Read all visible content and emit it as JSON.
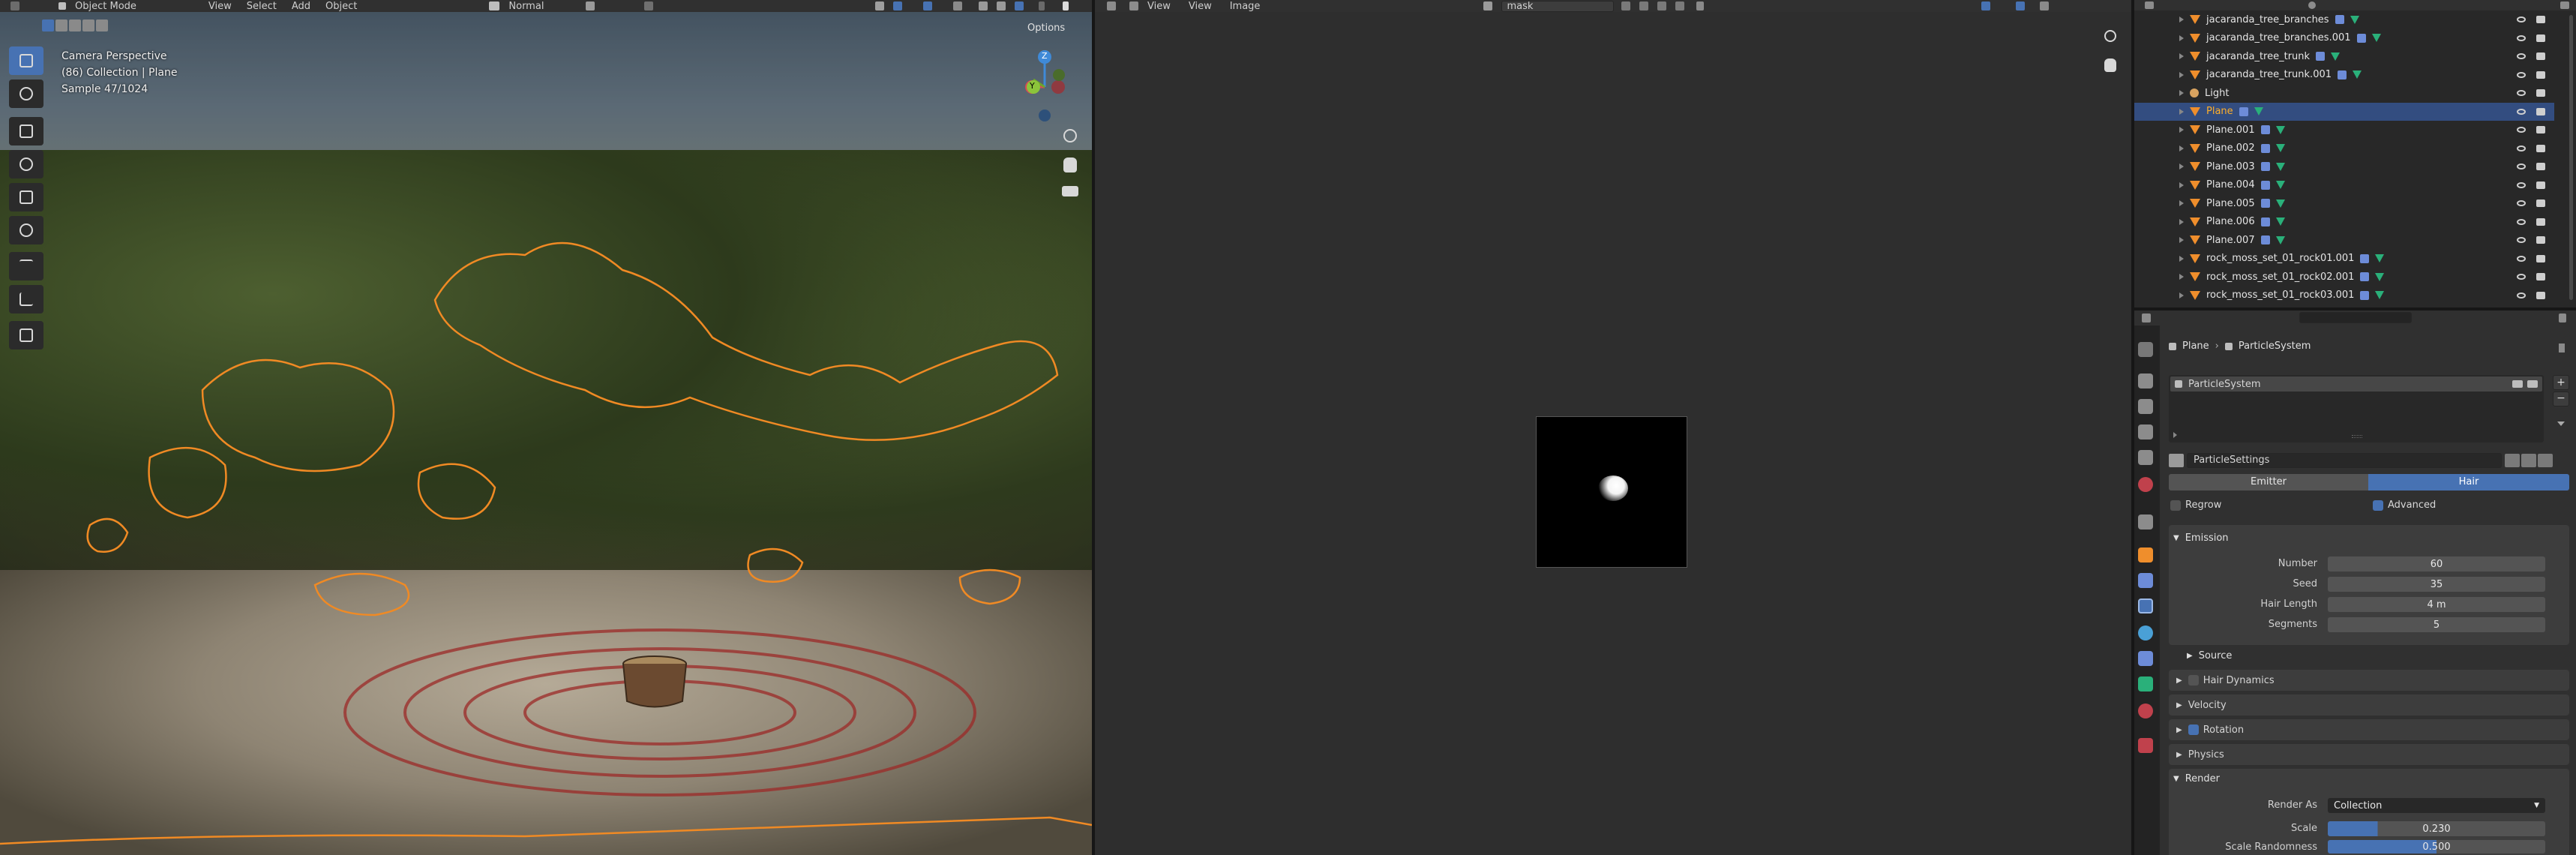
{
  "viewport_header": {
    "mode": "Object Mode",
    "menus": [
      "View",
      "Select",
      "Add",
      "Object"
    ],
    "orientation": "Normal",
    "options": "Options"
  },
  "viewport_overlay": {
    "line1": "Camera Perspective",
    "line2": "(86) Collection | Plane",
    "line3": "Sample 47/1024"
  },
  "gizmo": {
    "z": "Z",
    "y": "Y"
  },
  "image_editor": {
    "menus": [
      "View",
      "View",
      "Image"
    ],
    "image_name": "mask"
  },
  "outliner": {
    "items": [
      {
        "name": "jacaranda_tree_branches",
        "type": "mesh",
        "selected": false
      },
      {
        "name": "jacaranda_tree_branches.001",
        "type": "mesh",
        "selected": false
      },
      {
        "name": "jacaranda_tree_trunk",
        "type": "mesh",
        "selected": false
      },
      {
        "name": "jacaranda_tree_trunk.001",
        "type": "mesh",
        "selected": false
      },
      {
        "name": "Light",
        "type": "light",
        "selected": false
      },
      {
        "name": "Plane",
        "type": "mesh",
        "selected": true
      },
      {
        "name": "Plane.001",
        "type": "mesh",
        "selected": false
      },
      {
        "name": "Plane.002",
        "type": "mesh",
        "selected": false
      },
      {
        "name": "Plane.003",
        "type": "mesh",
        "selected": false
      },
      {
        "name": "Plane.004",
        "type": "mesh",
        "selected": false
      },
      {
        "name": "Plane.005",
        "type": "mesh",
        "selected": false
      },
      {
        "name": "Plane.006",
        "type": "mesh",
        "selected": false
      },
      {
        "name": "Plane.007",
        "type": "mesh",
        "selected": false
      },
      {
        "name": "rock_moss_set_01_rock01.001",
        "type": "mesh",
        "selected": false
      },
      {
        "name": "rock_moss_set_01_rock02.001",
        "type": "mesh",
        "selected": false
      },
      {
        "name": "rock_moss_set_01_rock03.001",
        "type": "mesh",
        "selected": false
      }
    ]
  },
  "properties": {
    "breadcrumb_object": "Plane",
    "breadcrumb_system": "ParticleSystem",
    "system_list_item": "ParticleSystem",
    "settings_name": "ParticleSettings",
    "type_tabs": [
      "Emitter",
      "Hair"
    ],
    "regrow": "Regrow",
    "advanced": "Advanced",
    "emission": {
      "title": "Emission",
      "number_label": "Number",
      "number": "60",
      "seed_label": "Seed",
      "seed": "35",
      "hair_length_label": "Hair Length",
      "hair_length": "4 m",
      "segments_label": "Segments",
      "segments": "5"
    },
    "source": "Source",
    "hair_dynamics": "Hair Dynamics",
    "velocity": "Velocity",
    "rotation": "Rotation",
    "physics": "Physics",
    "render": {
      "title": "Render",
      "render_as_label": "Render As",
      "render_as": "Collection",
      "scale_label": "Scale",
      "scale": "0.230",
      "scale_rand_label": "Scale Randomness",
      "scale_rand": "0.500"
    }
  },
  "colors": {
    "accent": "#4772b3",
    "selection": "#334d80",
    "object_orange": "#ef8e2c",
    "mesh_green": "#2ab07a"
  }
}
